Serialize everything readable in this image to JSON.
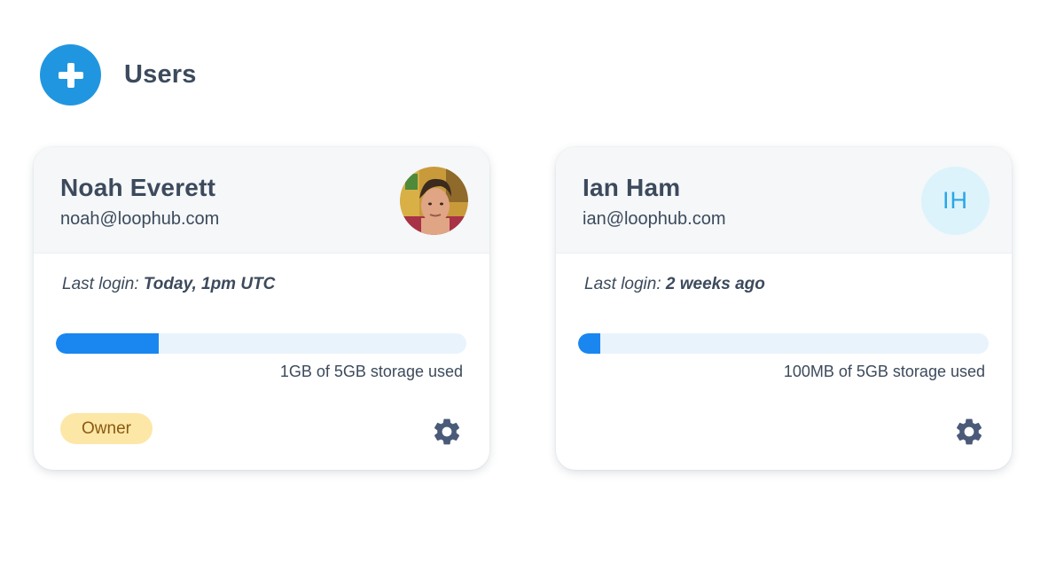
{
  "header": {
    "title": "Users",
    "add_icon": "plus-icon"
  },
  "colors": {
    "accent": "#2196e0",
    "progress_fill": "#1a86f0",
    "progress_track": "#e9f3fc",
    "badge_bg": "#fde7a7",
    "badge_text": "#8a5a10",
    "initials_bg": "#dcf3fc",
    "initials_text": "#2aa6e6",
    "text": "#3c4a5c"
  },
  "users": [
    {
      "name": "Noah Everett",
      "email": "noah@loophub.com",
      "avatar": "photo",
      "last_login_label": "Last login:",
      "last_login_value": "Today, 1pm UTC",
      "storage_used_fraction": 0.25,
      "storage_text": "1GB of 5GB storage used",
      "role": "Owner",
      "settings_icon": "gear-icon"
    },
    {
      "name": "Ian Ham",
      "email": "ian@loophub.com",
      "avatar_initials": "IH",
      "last_login_label": "Last login:",
      "last_login_value": "2 weeks ago",
      "storage_used_fraction": 0.055,
      "storage_text": "100MB of 5GB storage used",
      "settings_icon": "gear-icon"
    }
  ]
}
